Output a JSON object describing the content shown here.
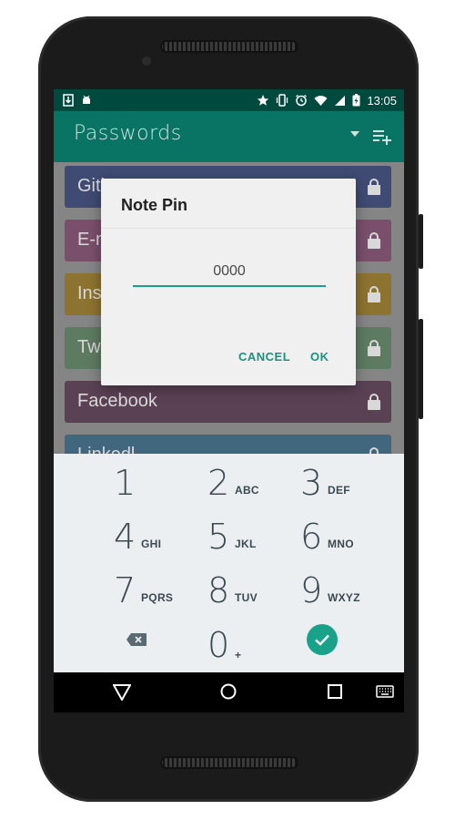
{
  "status_bar": {
    "time": "13:05"
  },
  "app_bar": {
    "title": "Passwords"
  },
  "entries": [
    {
      "label": "Gith",
      "color": "#3f4b73"
    },
    {
      "label": "E-m",
      "color": "#7a4f6c"
    },
    {
      "label": "Ins",
      "color": "#8d7330"
    },
    {
      "label": "Tw",
      "color": "#5d7b61"
    },
    {
      "label": "Facebook",
      "color": "#5b4154"
    },
    {
      "label": "Linkedl",
      "color": "#41677f"
    }
  ],
  "dialog": {
    "title": "Note Pin",
    "pin_value": "0000",
    "cancel_label": "CANCEL",
    "ok_label": "OK"
  },
  "keypad": {
    "keys": [
      {
        "digit": "1",
        "letters": ""
      },
      {
        "digit": "2",
        "letters": "ABC"
      },
      {
        "digit": "3",
        "letters": "DEF"
      },
      {
        "digit": "4",
        "letters": "GHI"
      },
      {
        "digit": "5",
        "letters": "JKL"
      },
      {
        "digit": "6",
        "letters": "MNO"
      },
      {
        "digit": "7",
        "letters": "PQRS"
      },
      {
        "digit": "8",
        "letters": "TUV"
      },
      {
        "digit": "9",
        "letters": "WXYZ"
      },
      {
        "digit": "0",
        "letters": "+"
      }
    ]
  },
  "colors": {
    "accent": "#19a28a",
    "app_bar": "#0a7464",
    "status_bar": "#00493f"
  }
}
